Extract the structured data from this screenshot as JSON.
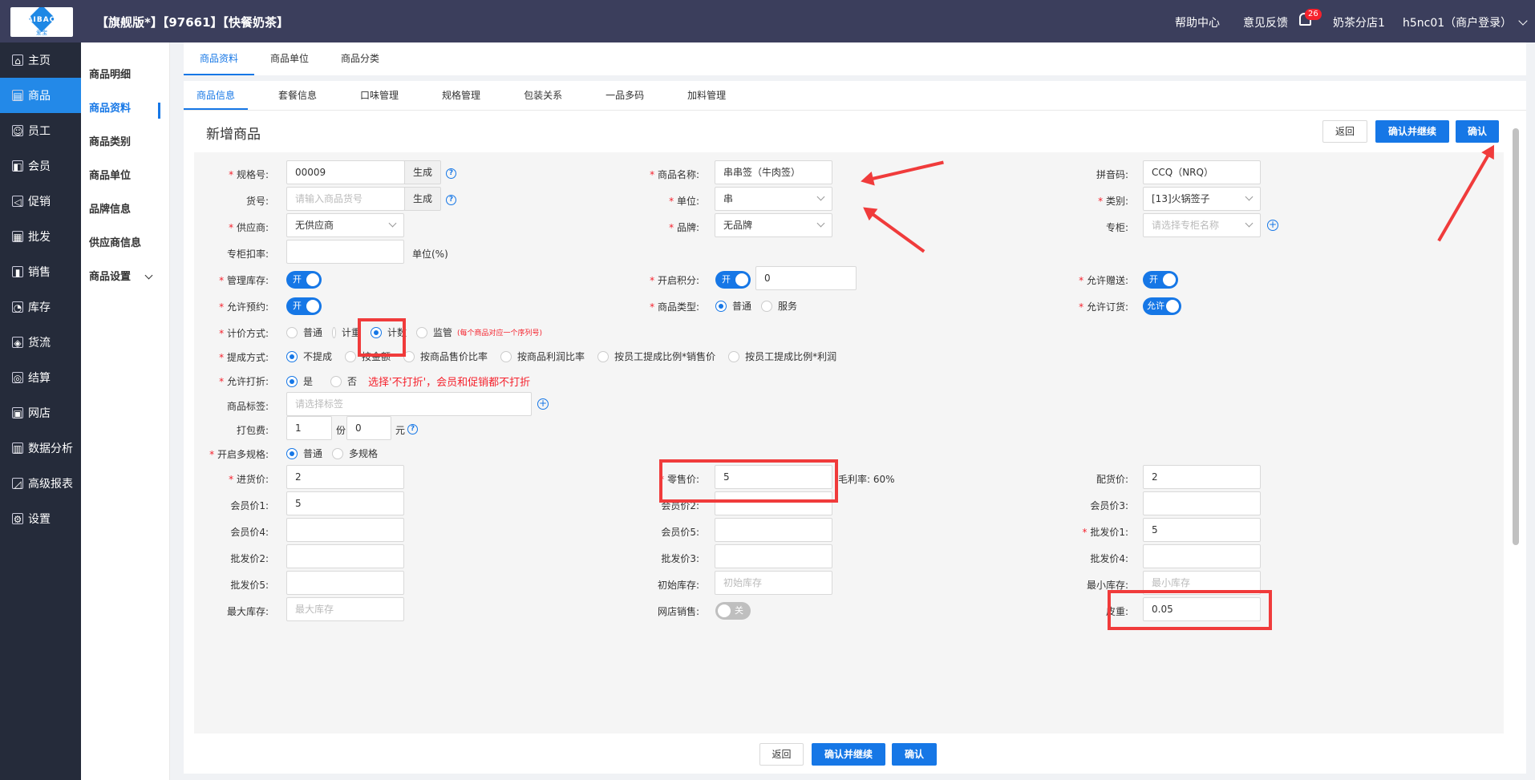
{
  "header": {
    "store": "【旗舰版*】【97661】【快餐奶茶】",
    "logo_text": "AIBAO",
    "logo_sub": "爱宝",
    "help": "帮助中心",
    "feedback": "意见反馈",
    "notif_count": "26",
    "branch": "奶茶分店1",
    "user": "h5nc01（商户登录）"
  },
  "sidebar": {
    "items": [
      {
        "label": "主页",
        "icon": "⌂"
      },
      {
        "label": "商品",
        "icon": "▤"
      },
      {
        "label": "员工",
        "icon": "☺"
      },
      {
        "label": "会员",
        "icon": "◧"
      },
      {
        "label": "促销",
        "icon": "◁"
      },
      {
        "label": "批发",
        "icon": "▦"
      },
      {
        "label": "销售",
        "icon": "▮"
      },
      {
        "label": "库存",
        "icon": "◔"
      },
      {
        "label": "货流",
        "icon": "◈"
      },
      {
        "label": "结算",
        "icon": "◎"
      },
      {
        "label": "网店",
        "icon": "▣"
      },
      {
        "label": "数据分析",
        "icon": "▥"
      },
      {
        "label": "高级报表",
        "icon": "◿"
      },
      {
        "label": "设置",
        "icon": "⚙"
      }
    ]
  },
  "submenu": {
    "items": [
      "商品明细",
      "商品资料",
      "商品类别",
      "商品单位",
      "品牌信息",
      "供应商信息",
      "商品设置"
    ]
  },
  "tabs_top": [
    "商品资料",
    "商品单位",
    "商品分类"
  ],
  "tabs_sub": [
    "商品信息",
    "套餐信息",
    "口味管理",
    "规格管理",
    "包装关系",
    "一品多码",
    "加料管理"
  ],
  "page": {
    "title": "新增商品",
    "back": "返回",
    "confirm_continue": "确认并继续",
    "confirm": "确认"
  },
  "form": {
    "spec_no": {
      "label": "规格号:",
      "value": "00009",
      "gen": "生成"
    },
    "item_no": {
      "label": "货号:",
      "placeholder": "请输入商品货号",
      "gen": "生成"
    },
    "name": {
      "label": "商品名称:",
      "value": "串串签（牛肉签）"
    },
    "pinyin": {
      "label": "拼音码:",
      "value": "CCQ（NRQ）"
    },
    "unit": {
      "label": "单位:",
      "value": "串"
    },
    "category": {
      "label": "类别:",
      "value": "[13]火锅签子"
    },
    "supplier": {
      "label": "供应商:",
      "value": "无供应商"
    },
    "brand": {
      "label": "品牌:",
      "value": "无品牌"
    },
    "counter": {
      "label": "专柜:",
      "placeholder": "请选择专柜名称"
    },
    "counter_deduct": {
      "label": "专柜扣率:",
      "unit": "单位(%)"
    },
    "manage_stock": {
      "label": "管理库存:",
      "state": "开"
    },
    "points": {
      "label": "开启积分:",
      "state": "开",
      "value": "0"
    },
    "gift": {
      "label": "允许赠送:",
      "state": "开"
    },
    "reserve": {
      "label": "允许预约:",
      "state": "开"
    },
    "item_type": {
      "label": "商品类型:",
      "options": [
        "普通",
        "服务"
      ],
      "selected": 0
    },
    "allow_order": {
      "label": "允许订货:",
      "state": "允许"
    },
    "pricing": {
      "label": "计价方式:",
      "options": [
        "普通",
        "计重",
        "计数",
        "监管"
      ],
      "selected": 2,
      "note": "(每个商品对应一个序列号)"
    },
    "commission": {
      "label": "提成方式:",
      "options": [
        "不提成",
        "按金额",
        "按商品售价比率",
        "按商品利润比率",
        "按员工提成比例*销售价",
        "按员工提成比例*利润"
      ],
      "selected": 0
    },
    "discount": {
      "label": "允许打折:",
      "options": [
        "是",
        "否"
      ],
      "selected": 0,
      "note": "选择'不打折'，会员和促销都不打折"
    },
    "tags": {
      "label": "商品标签:",
      "placeholder": "请选择标签"
    },
    "packing": {
      "label": "打包费:",
      "qty": "1",
      "qty_unit": "份",
      "price": "0",
      "price_unit": "元"
    },
    "multi_spec": {
      "label": "开启多规格:",
      "options": [
        "普通",
        "多规格"
      ],
      "selected": 0
    },
    "purchase_price": {
      "label": "进货价:",
      "value": "2"
    },
    "retail_price": {
      "label": "零售价:",
      "value": "5"
    },
    "margin": {
      "label": "毛利率:",
      "value": "60%"
    },
    "delivery_price": {
      "label": "配货价:",
      "value": "2"
    },
    "member1": {
      "label": "会员价1:",
      "value": "5"
    },
    "member2": {
      "label": "会员价2:",
      "value": ""
    },
    "member3": {
      "label": "会员价3:",
      "value": ""
    },
    "member4": {
      "label": "会员价4:",
      "value": ""
    },
    "member5": {
      "label": "会员价5:",
      "value": ""
    },
    "wholesale1": {
      "label": "批发价1:",
      "value": "5"
    },
    "wholesale2": {
      "label": "批发价2:",
      "value": ""
    },
    "wholesale3": {
      "label": "批发价3:",
      "value": ""
    },
    "wholesale4": {
      "label": "批发价4:",
      "value": ""
    },
    "wholesale5": {
      "label": "批发价5:",
      "value": ""
    },
    "init_stock": {
      "label": "初始库存:",
      "placeholder": "初始库存"
    },
    "min_stock": {
      "label": "最小库存:",
      "placeholder": "最小库存"
    },
    "max_stock": {
      "label": "最大库存:",
      "placeholder": "最大库存"
    },
    "online_sale": {
      "label": "网店销售:",
      "state": "关"
    },
    "tare": {
      "label": "皮重:",
      "value": "0.05"
    }
  },
  "colors": {
    "primary": "#1677e6",
    "topbar": "#3b3e5c",
    "sidebar": "#252b3a",
    "annotation": "#f03b3b"
  }
}
